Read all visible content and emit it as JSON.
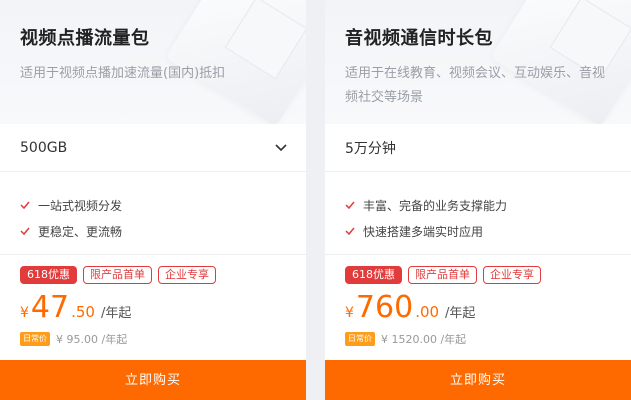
{
  "cards": [
    {
      "title": "视频点播流量包",
      "desc": "适用于视频点播加速流量(国内)抵扣",
      "spec_value": "500GB",
      "has_dropdown": true,
      "features": [
        "一站式视频分发",
        "更稳定、更流畅"
      ],
      "tags": [
        "618优惠",
        "限产品首单",
        "企业专享"
      ],
      "price_currency": "¥",
      "price_int": "47",
      "price_dec": ".50",
      "price_unit": "/年起",
      "orig_badge": "日常价",
      "orig_price": "¥ 95.00 /年起",
      "buy_label": "立即购买"
    },
    {
      "title": "音视频通信时长包",
      "desc": "适用于在线教育、视频会议、互动娱乐、音视频社交等场景",
      "spec_value": "5万分钟",
      "has_dropdown": false,
      "features": [
        "丰富、完备的业务支撑能力",
        "快速搭建多端实时应用"
      ],
      "tags": [
        "618优惠",
        "限产品首单",
        "企业专享"
      ],
      "price_currency": "¥",
      "price_int": "760",
      "price_dec": ".00",
      "price_unit": "/年起",
      "orig_badge": "日常价",
      "orig_price": "¥ 1520.00 /年起",
      "buy_label": "立即购买"
    }
  ],
  "colors": {
    "accent": "#ff6a00",
    "tag_red": "#e23b3b",
    "badge_orange": "#ff9c1a",
    "check_red": "#e23b3b"
  },
  "icons": {
    "dropdown": "chevron-down-icon",
    "feature": "check-icon"
  }
}
